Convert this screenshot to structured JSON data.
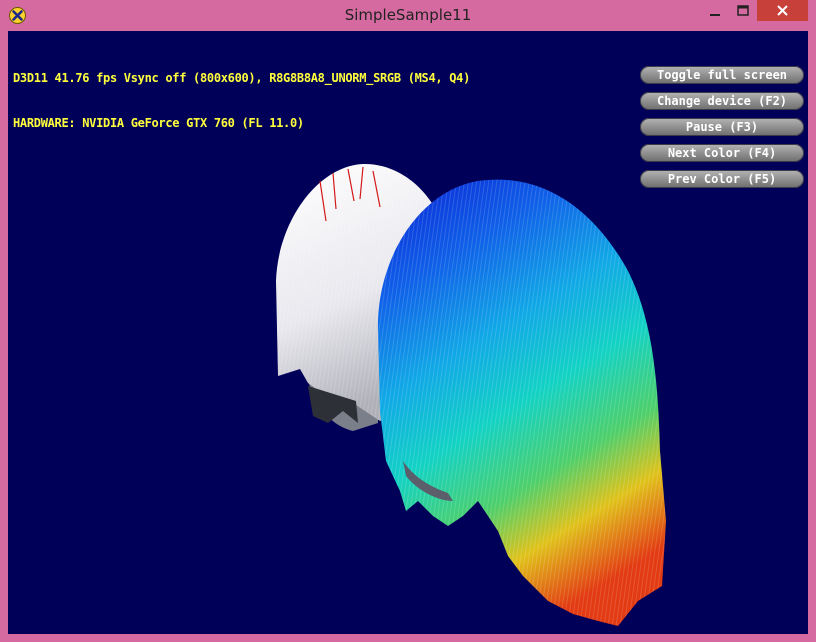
{
  "window": {
    "title": "SimpleSample11"
  },
  "stats": {
    "line1": "D3D11 41.76 fps Vsync off (800x600), R8G8B8A8_UNORM_SRGB (MS4, Q4)",
    "line2": "HARDWARE: NVIDIA GeForce GTX 760 (FL 11.0)"
  },
  "hud": {
    "toggle_fullscreen": "Toggle full screen",
    "change_device": "Change device (F2)",
    "pause": "Pause (F3)",
    "next_color": "Next Color (F4)",
    "prev_color": "Prev Color (F5)"
  },
  "colors": {
    "frame": "#d46a9f",
    "background": "#000059",
    "stats_text": "#ffff3c",
    "close_button": "#c7403a"
  }
}
